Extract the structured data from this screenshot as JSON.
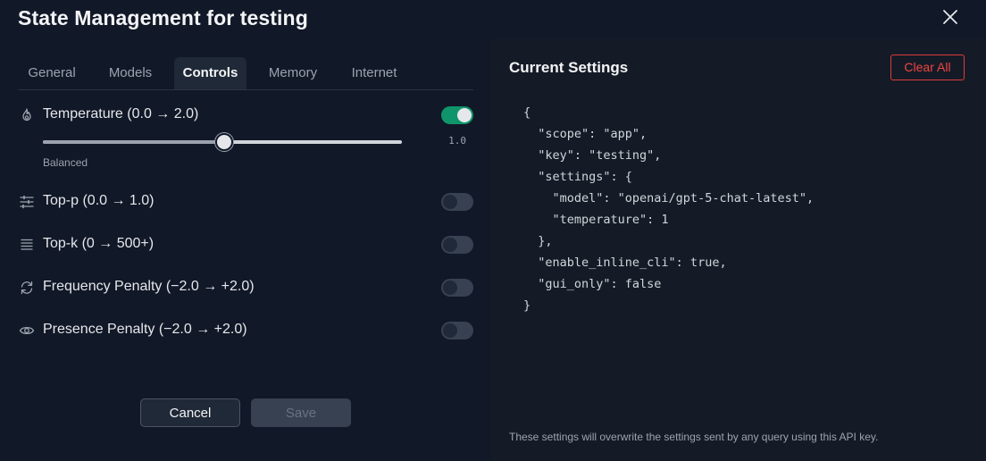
{
  "dialog": {
    "title": "State Management for testing"
  },
  "tabs": [
    {
      "label": "General",
      "active": false
    },
    {
      "label": "Models",
      "active": false
    },
    {
      "label": "Controls",
      "active": true
    },
    {
      "label": "Memory",
      "active": false
    },
    {
      "label": "Internet",
      "active": false
    }
  ],
  "controls": {
    "temperature": {
      "label": "Temperature (0.0 → 2.0)",
      "icon": "flame-icon",
      "enabled": true,
      "value_text": "1.0",
      "value": 1.0,
      "min": 0.0,
      "max": 2.0,
      "caption": "Balanced"
    },
    "top_p": {
      "label": "Top-p (0.0 → 1.0)",
      "icon": "sliders-icon",
      "enabled": false
    },
    "top_k": {
      "label": "Top-k (0 → 500+)",
      "icon": "list-icon",
      "enabled": false
    },
    "frequency_penalty": {
      "label": "Frequency Penalty (−2.0 → +2.0)",
      "icon": "refresh-icon",
      "enabled": false
    },
    "presence_penalty": {
      "label": "Presence Penalty (−2.0 → +2.0)",
      "icon": "eye-icon",
      "enabled": false
    }
  },
  "footer": {
    "cancel_label": "Cancel",
    "save_label": "Save"
  },
  "panel": {
    "title": "Current Settings",
    "clear_label": "Clear All",
    "json_text": "{\n  \"scope\": \"app\",\n  \"key\": \"testing\",\n  \"settings\": {\n    \"model\": \"openai/gpt-5-chat-latest\",\n    \"temperature\": 1\n  },\n  \"enable_inline_cli\": true,\n  \"gui_only\": false\n}",
    "note": "These settings will overwrite the settings sent by any query using this API key."
  },
  "colors": {
    "background": "#111827",
    "panel": "#151b26",
    "toggle_on": "#10956a",
    "danger": "#ef4444"
  }
}
